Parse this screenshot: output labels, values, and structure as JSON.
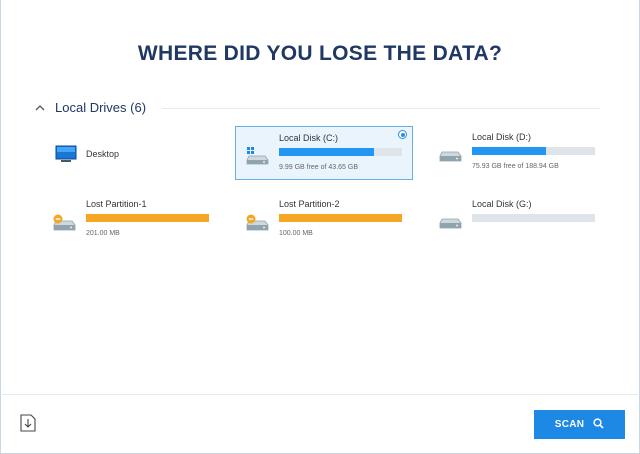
{
  "page": {
    "title": "WHERE DID YOU LOSE THE DATA?"
  },
  "section": {
    "label": "Local Drives (6)",
    "expanded": true
  },
  "desktop": {
    "label": "Desktop"
  },
  "drives": [
    {
      "name": "Local Disk (C:)",
      "size": "9.99 GB free of 43.65 GB",
      "used_fraction": 0.77,
      "bar_color": "#2196f3",
      "icon": "windows-disk-icon",
      "selected": true
    },
    {
      "name": "Local Disk (D:)",
      "size": "75.93 GB free of 188.94 GB",
      "used_fraction": 0.6,
      "bar_color": "#2196f3",
      "icon": "disk-icon",
      "selected": false
    },
    {
      "name": "Lost Partition-1",
      "size": "201.00 MB",
      "used_fraction": 1.0,
      "bar_color": "#f5a623",
      "icon": "lost-partition-icon",
      "selected": false
    },
    {
      "name": "Lost Partition-2",
      "size": "100.00 MB",
      "used_fraction": 1.0,
      "bar_color": "#f5a623",
      "icon": "lost-partition-icon",
      "selected": false
    },
    {
      "name": "Local Disk (G:)",
      "size": "",
      "used_fraction": 0.0,
      "bar_color": "#2196f3",
      "icon": "disk-icon",
      "selected": false
    }
  ],
  "footer": {
    "scan_label": "SCAN"
  },
  "colors": {
    "accent": "#1e88e5",
    "title": "#1f3864",
    "lost_partition": "#f5a623"
  }
}
